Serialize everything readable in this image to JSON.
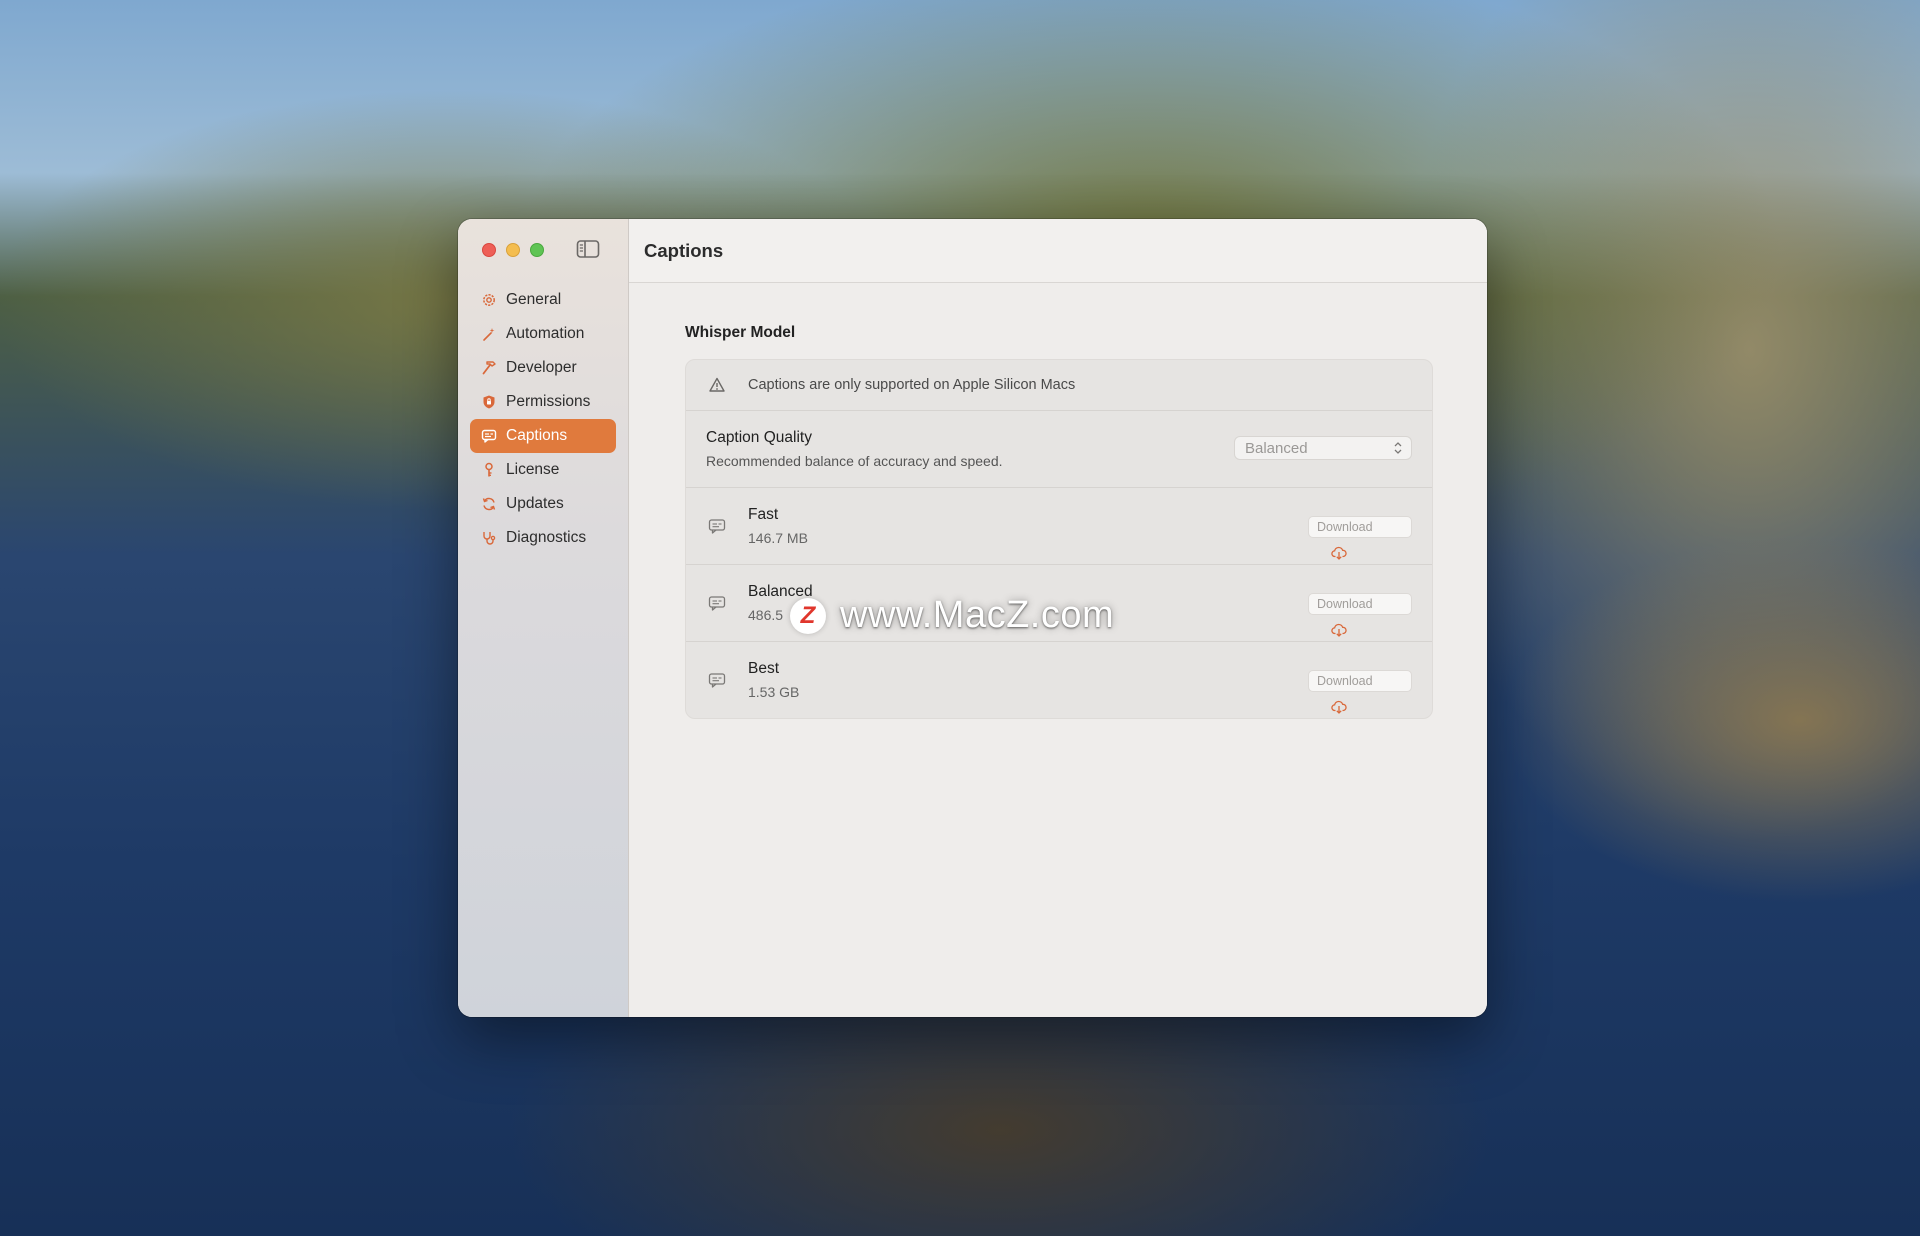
{
  "window": {
    "title": "Captions"
  },
  "sidebar": {
    "items": [
      {
        "label": "General",
        "icon": "gear-icon",
        "active": false
      },
      {
        "label": "Automation",
        "icon": "wand-icon",
        "active": false
      },
      {
        "label": "Developer",
        "icon": "hammer-icon",
        "active": false
      },
      {
        "label": "Permissions",
        "icon": "shield-icon",
        "active": false
      },
      {
        "label": "Captions",
        "icon": "caption-bubble-icon",
        "active": true
      },
      {
        "label": "License",
        "icon": "key-icon",
        "active": false
      },
      {
        "label": "Updates",
        "icon": "refresh-icon",
        "active": false
      },
      {
        "label": "Diagnostics",
        "icon": "stethoscope-icon",
        "active": false
      }
    ]
  },
  "main": {
    "section_title": "Whisper Model",
    "warning": "Captions are only supported on Apple Silicon Macs",
    "quality": {
      "label": "Caption Quality",
      "description": "Recommended balance of accuracy and speed.",
      "selected": "Balanced"
    },
    "models": [
      {
        "name": "Fast",
        "size": "146.7 MB",
        "button": "Download"
      },
      {
        "name": "Balanced",
        "size": "486.5",
        "button": "Download"
      },
      {
        "name": "Best",
        "size": "1.53 GB",
        "button": "Download"
      }
    ]
  },
  "watermark": {
    "logo": "Z",
    "text": "www.MacZ.com"
  },
  "colors": {
    "accent": "#e07a3d",
    "accent_icon": "#d9683a"
  }
}
